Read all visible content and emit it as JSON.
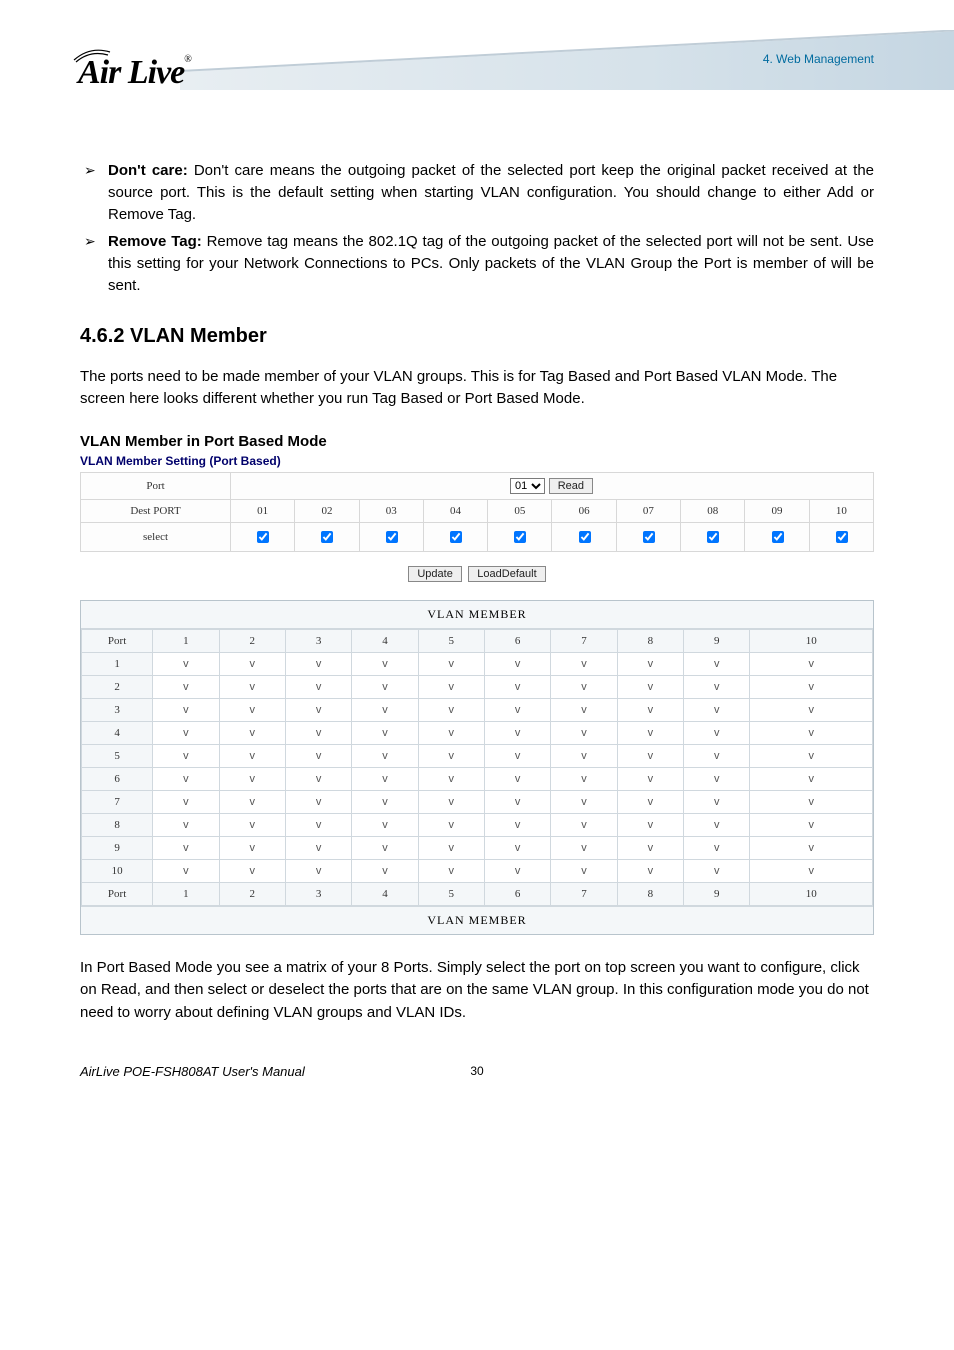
{
  "header": {
    "chapter": "4. Web Management",
    "logo_text": "Air Live",
    "logo_reg": "®"
  },
  "bullets": [
    {
      "label": "Don't care:",
      "text": " Don't care means the outgoing packet of the selected port keep the original packet received at the source port. This is the default setting when starting VLAN configuration. You should change to either Add or Remove Tag."
    },
    {
      "label": "Remove Tag:",
      "text": " Remove tag means the 802.1Q tag of the outgoing packet of the selected port will not be sent. Use this setting for your Network Connections to PCs. Only packets of the VLAN Group the Port is member of will be sent."
    }
  ],
  "section_title": "4.6.2 VLAN Member",
  "section_intro": "The ports need to be made member of your VLAN groups. This is for Tag Based and Port Based VLAN Mode. The screen here looks different whether you run Tag Based or Port Based Mode.",
  "subhead": "VLAN Member in Port Based Mode",
  "panel_caption": "VLAN Member Setting (Port Based)",
  "cfg": {
    "rows": {
      "port_label": "Port",
      "port_select_value": "01",
      "read_btn": "Read",
      "dest_label": "Dest PORT",
      "dest_cols": [
        "01",
        "02",
        "03",
        "04",
        "05",
        "06",
        "07",
        "08",
        "09",
        "10"
      ],
      "select_label": "select"
    },
    "buttons": {
      "update": "Update",
      "load_default": "LoadDefault"
    }
  },
  "matrix": {
    "title": "VLAN MEMBER",
    "head_label": "Port",
    "cols": [
      "1",
      "2",
      "3",
      "4",
      "5",
      "6",
      "7",
      "8",
      "9",
      "10"
    ],
    "rows": [
      "1",
      "2",
      "3",
      "4",
      "5",
      "6",
      "7",
      "8",
      "9",
      "10"
    ],
    "cell": "v",
    "footer_title": "VLAN MEMBER"
  },
  "after_para": "In Port Based Mode you see a matrix of your 8 Ports. Simply select the port on top screen you want to configure, click on Read, and then select or deselect the ports that are on the same VLAN group. In this configuration mode you do not need to worry about defining VLAN groups and VLAN IDs.",
  "footer": {
    "manual": "AirLive POE-FSH808AT User's Manual",
    "page": "30"
  }
}
